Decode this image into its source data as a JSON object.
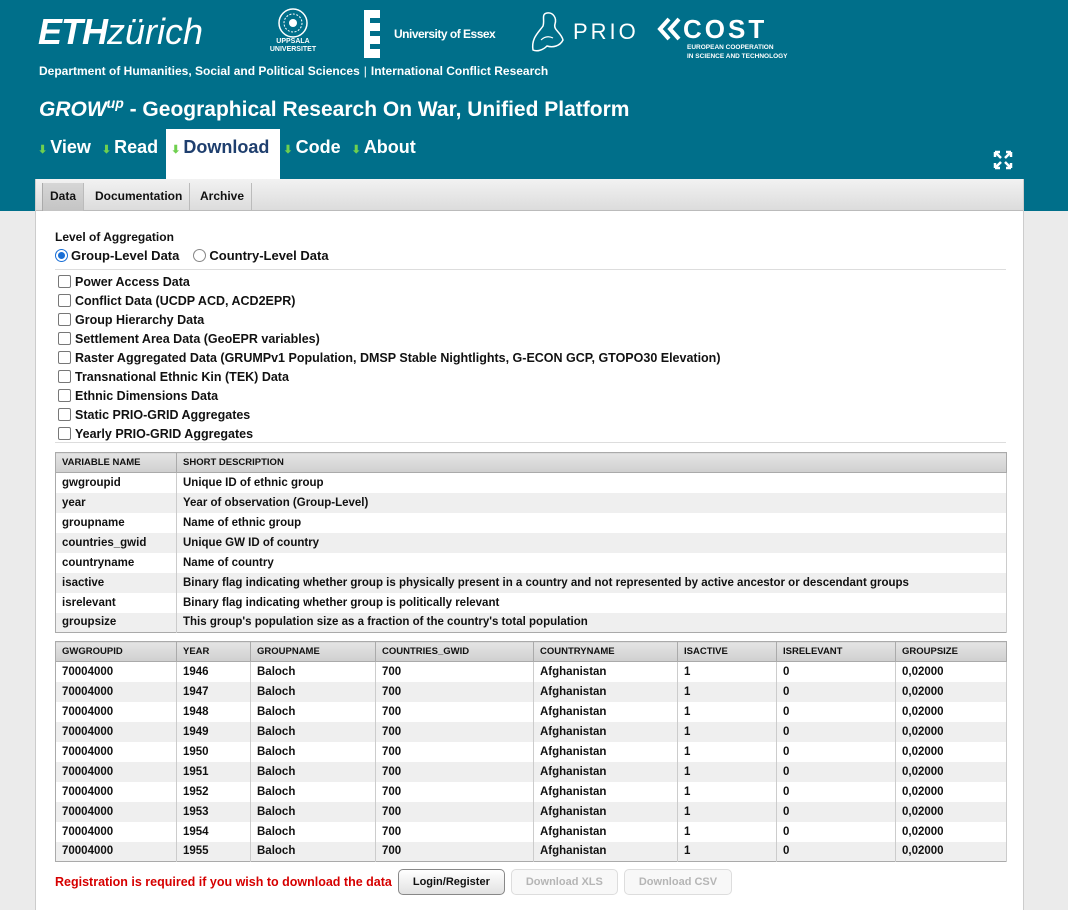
{
  "header": {
    "logos": {
      "eth_bold": "ETH",
      "eth_light": "zürich",
      "uppsala": "UPPSALA UNIVERSITET",
      "essex": "University of Essex",
      "prio": "PRIO",
      "cost": "COST",
      "cost_sub1": "EUROPEAN COOPERATION",
      "cost_sub2": "IN SCIENCE AND TECHNOLOGY"
    },
    "dept": "Department of Humanities, Social and Political Sciences",
    "dept_sep": "|",
    "dept_2": "International Conflict Research",
    "title_grow": "GROW",
    "title_sup": "up",
    "title_rest": " - Geographical Research On War, Unified Platform"
  },
  "nav": {
    "items": [
      {
        "label": "View"
      },
      {
        "label": "Read"
      },
      {
        "label": "Download"
      },
      {
        "label": "Code"
      },
      {
        "label": "About"
      }
    ],
    "active": "Download"
  },
  "subtabs": [
    "Data",
    "Documentation",
    "Archive"
  ],
  "aggregation": {
    "label": "Level of Aggregation",
    "options": [
      "Group-Level Data",
      "Country-Level Data"
    ],
    "selected": "Group-Level Data"
  },
  "datasets": [
    "Power Access Data",
    "Conflict Data (UCDP ACD, ACD2EPR)",
    "Group Hierarchy Data",
    "Settlement Area Data (GeoEPR variables)",
    "Raster Aggregated Data (GRUMPv1 Population, DMSP Stable Nightlights, G-ECON GCP, GTOPO30 Elevation)",
    "Transnational Ethnic Kin (TEK) Data",
    "Ethnic Dimensions Data",
    "Static PRIO-GRID Aggregates",
    "Yearly PRIO-GRID Aggregates"
  ],
  "variables": {
    "headers": [
      "VARIABLE NAME",
      "SHORT DESCRIPTION"
    ],
    "rows": [
      [
        "gwgroupid",
        "Unique ID of ethnic group"
      ],
      [
        "year",
        "Year of observation (Group-Level)"
      ],
      [
        "groupname",
        "Name of ethnic group"
      ],
      [
        "countries_gwid",
        "Unique GW ID of country"
      ],
      [
        "countryname",
        "Name of country"
      ],
      [
        "isactive",
        "Binary flag indicating whether group is physically present in a country and not represented by active ancestor or descendant groups"
      ],
      [
        "isrelevant",
        "Binary flag indicating whether group is politically relevant"
      ],
      [
        "groupsize",
        "This group's population size as a fraction of the country's total population"
      ]
    ]
  },
  "preview": {
    "headers": [
      "GWGROUPID",
      "YEAR",
      "GROUPNAME",
      "COUNTRIES_GWID",
      "COUNTRYNAME",
      "ISACTIVE",
      "ISRELEVANT",
      "GROUPSIZE"
    ],
    "rows": [
      [
        "70004000",
        "1946",
        "Baloch",
        "700",
        "Afghanistan",
        "1",
        "0",
        "0,02000"
      ],
      [
        "70004000",
        "1947",
        "Baloch",
        "700",
        "Afghanistan",
        "1",
        "0",
        "0,02000"
      ],
      [
        "70004000",
        "1948",
        "Baloch",
        "700",
        "Afghanistan",
        "1",
        "0",
        "0,02000"
      ],
      [
        "70004000",
        "1949",
        "Baloch",
        "700",
        "Afghanistan",
        "1",
        "0",
        "0,02000"
      ],
      [
        "70004000",
        "1950",
        "Baloch",
        "700",
        "Afghanistan",
        "1",
        "0",
        "0,02000"
      ],
      [
        "70004000",
        "1951",
        "Baloch",
        "700",
        "Afghanistan",
        "1",
        "0",
        "0,02000"
      ],
      [
        "70004000",
        "1952",
        "Baloch",
        "700",
        "Afghanistan",
        "1",
        "0",
        "0,02000"
      ],
      [
        "70004000",
        "1953",
        "Baloch",
        "700",
        "Afghanistan",
        "1",
        "0",
        "0,02000"
      ],
      [
        "70004000",
        "1954",
        "Baloch",
        "700",
        "Afghanistan",
        "1",
        "0",
        "0,02000"
      ],
      [
        "70004000",
        "1955",
        "Baloch",
        "700",
        "Afghanistan",
        "1",
        "0",
        "0,02000"
      ]
    ]
  },
  "footer": {
    "warning": "Registration is required if you wish to download the data",
    "login": "Login/Register",
    "xls": "Download XLS",
    "csv": "Download CSV"
  },
  "icons": {
    "nav_arrow": "arrow-down-icon",
    "fullscreen": "fullscreen-icon"
  },
  "colors": {
    "header_bg": "#006f8a",
    "nav_arrow": "#6fd04f",
    "active_tab_text": "#1f3f6e",
    "warning": "#d60000"
  }
}
